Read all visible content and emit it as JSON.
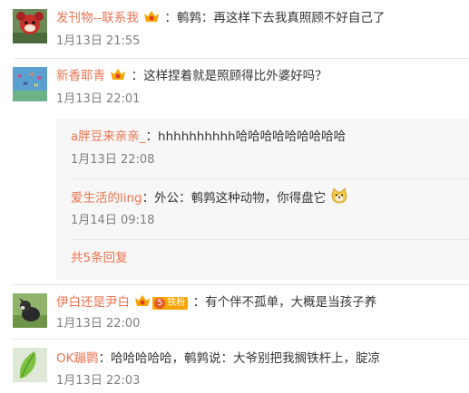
{
  "comments": [
    {
      "user": "发刊物--联系我",
      "text": "：鹌鹑：再这样下去我真照顾不好自己了",
      "time": "1月13日 21:55",
      "avatar_icon": "red-mascot-avatar-icon",
      "badge_icon": "vip-crown-badge-icon"
    },
    {
      "user": "新香耶青",
      "text": "：这样捏着就是照顾得比外婆好吗？",
      "time": "1月13日 22:01",
      "avatar_icon": "butterflies-avatar-icon",
      "badge_icon": "vip-crown-badge-icon"
    },
    {
      "user": "伊白还是尹白",
      "text": "：有个伴不孤单，大概是当孩子养",
      "time": "1月13日 22:00",
      "avatar_icon": "dog-avatar-icon",
      "badge_icon": "vip-crown-badge-icon",
      "fan_badge": "铁粉",
      "fan_level": "5"
    },
    {
      "user": "OK蹦鹮",
      "text": "：哈哈哈哈哈，鹌鹑说：大爷别把我搁铁杆上，腚凉",
      "time": "1月13日 22:03",
      "avatar_icon": "green-leaf-avatar-icon"
    }
  ],
  "replies": [
    {
      "user": "a胖豆来亲亲_",
      "text": "：hhhhhhhhhh哈哈哈哈哈哈哈哈哈",
      "time": "1月13日 22:08"
    },
    {
      "user": "爱生活的ling",
      "text": "：外公：鹌鹑这种动物，你得盘它",
      "time": "1月14日 09:18",
      "emoji_icon": "doge-emoji-icon"
    }
  ],
  "more_replies": "共5条回复",
  "colors": {
    "username": "#eb7350",
    "time": "#808080",
    "reply_bg": "#f7f7f7",
    "badge": "#f7a400"
  }
}
